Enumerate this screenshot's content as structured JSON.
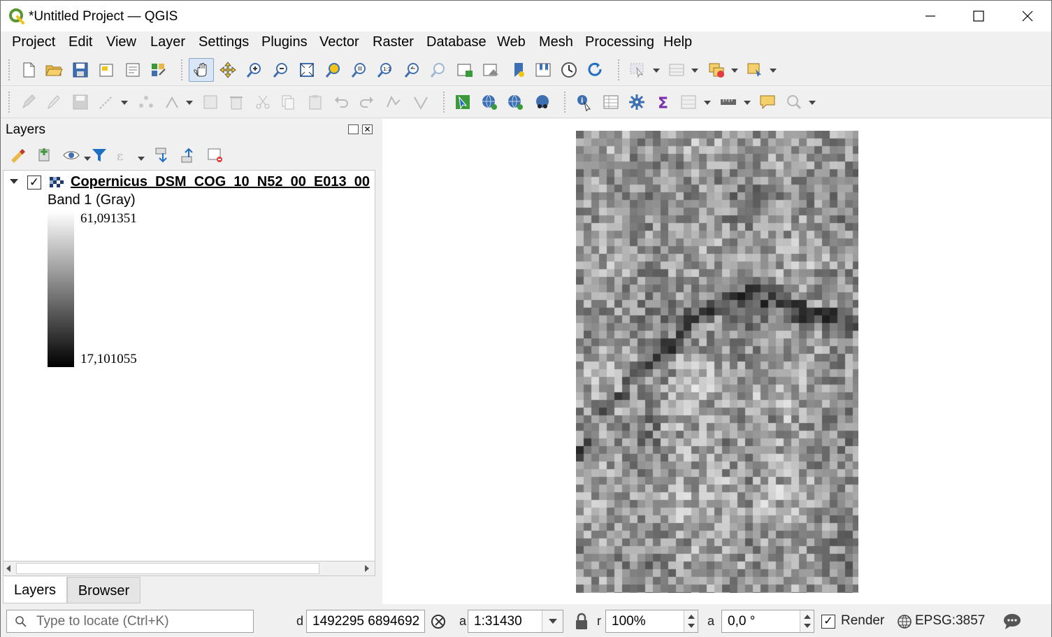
{
  "window": {
    "title": "*Untitled Project — QGIS"
  },
  "menubar": {
    "items": [
      {
        "label": "Project"
      },
      {
        "label": "Edit"
      },
      {
        "label": "View"
      },
      {
        "label": "Layer"
      },
      {
        "label": "Settings"
      },
      {
        "label": "Plugins"
      },
      {
        "label": "Vector"
      },
      {
        "label": "Raster"
      },
      {
        "label": "Database"
      },
      {
        "label": "Web"
      },
      {
        "label": "Mesh"
      },
      {
        "label": "Processing"
      },
      {
        "label": "Help"
      }
    ]
  },
  "layers_panel": {
    "title": "Layers",
    "layer": {
      "name": "Copernicus_DSM_COG_10_N52_00_E013_00",
      "checked": true,
      "band_label": "Band 1 (Gray)",
      "max_value": "61,091351",
      "min_value": "17,101055"
    },
    "tabs": [
      {
        "label": "Layers",
        "active": true
      },
      {
        "label": "Browser",
        "active": false
      }
    ]
  },
  "statusbar": {
    "locator_placeholder": "Type to locate (Ctrl+K)",
    "coordinate_label": "d",
    "coordinate": "1492295  6894692",
    "scale_label": "a",
    "scale": "1:31430",
    "magnifier_label": "r",
    "magnifier": "100%",
    "rotation_label": "a",
    "rotation": "0,0 °",
    "render_label": "Render",
    "render_checked": true,
    "crs": "EPSG:3857"
  },
  "colors": {
    "toolbar_bg": "#f0f0f0",
    "qgis_green": "#589632",
    "accent_blue": "#1f6fc5"
  }
}
